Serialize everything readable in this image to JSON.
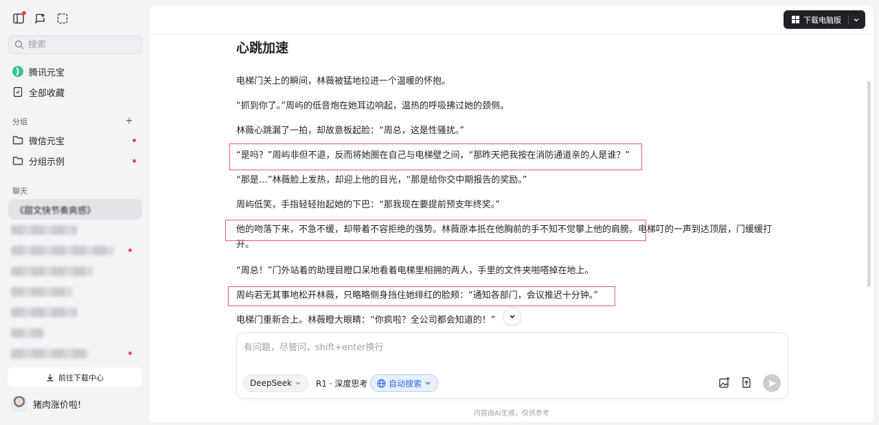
{
  "sidebar": {
    "search_placeholder": "搜索",
    "nav": {
      "yuanbao": "腾讯元宝",
      "favorites": "全部收藏"
    },
    "groups_label": "分组",
    "groups": [
      {
        "label": "微信元宝"
      },
      {
        "label": "分组示例"
      }
    ],
    "chat_label": "聊天",
    "active_chat": "《甜文快节奏爽感》",
    "download_center": "前往下载中心",
    "username": "猪肉涨价啦!"
  },
  "header": {
    "download_pc": "下载电脑版"
  },
  "document": {
    "title": "心跳加速",
    "paragraphs": [
      "电梯门关上的瞬间，林薇被猛地拉进一个温暖的怀抱。",
      "“抓到你了。”周屿的低音炮在她耳边响起，温热的呼吸拂过她的颈侧。",
      "林薇心跳漏了一拍，却故意板起脸：“周总，这是性骚扰。”",
      "“是吗？”周屿非但不退，反而将她圈在自己与电梯壁之间，“那昨天把我按在消防通道亲的人是谁？”",
      "“那是…”林薇脸上发热，却迎上他的目光，“那是给你交中期报告的奖励。”",
      "周屿低笑，手指轻轻抬起她的下巴：“那我现在要提前预支年终奖。”",
      "他的吻落下来，不急不缓，却带着不容拒绝的强势。林薇原本抵在他胸前的手不知不觉攀上他的肩膀。电梯叮的一声到达顶层，门缓缓打开。",
      "“周总！”门外站着的助理目瞪口呆地看着电梯里相拥的两人，手里的文件夹啪嗒掉在地上。",
      "周屿若无其事地松开林薇，只略略侧身挡住她绯红的脸颊：“通知各部门，会议推迟十分钟。”",
      "电梯门重新合上。林薇瞪大眼睛：“你疯啦？全公司都会知道的！”"
    ]
  },
  "composer": {
    "placeholder": "有问题，尽管问，shift+enter换行",
    "model": "DeepSeek",
    "r1": "R1 · 深度思考",
    "auto_search": "自动搜索"
  },
  "footnote": "内容由AI生成，仅供参考",
  "colors": {
    "highlight_box": "#e85a5a",
    "accent": "#2e6be6"
  }
}
